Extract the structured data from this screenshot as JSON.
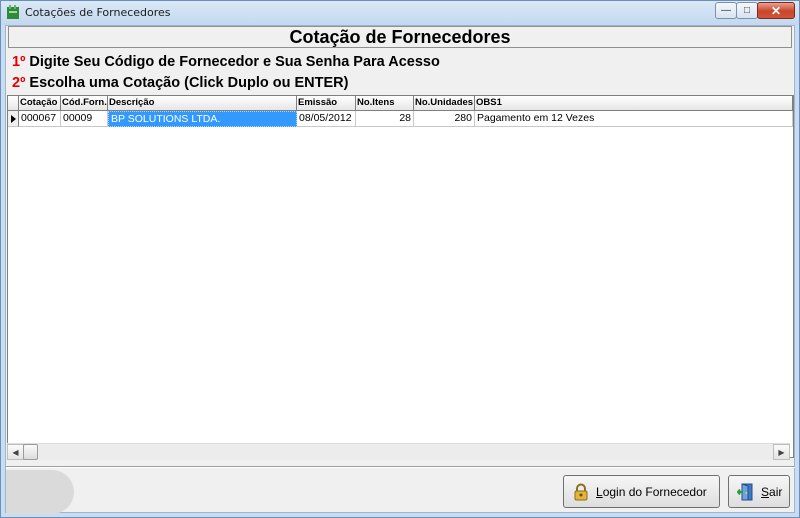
{
  "window": {
    "title": "Cotações de Fornecedores",
    "controls": {
      "minimize": "—",
      "maximize": "□",
      "close": "✕"
    }
  },
  "form": {
    "heading": "Cotação de Fornecedores",
    "instruction1": {
      "num": "1º",
      "text": " Digite Seu Código de Fornecedor e Sua Senha Para Acesso"
    },
    "instruction2": {
      "num": "2º",
      "text": " Escolha uma Cotação  (Click Duplo ou ENTER)"
    }
  },
  "grid": {
    "columns": [
      "Cotação",
      "Cód.Forn.",
      "Descrição",
      "Emissão",
      "No.Itens",
      "No.Unidades",
      "OBS1"
    ],
    "rows": [
      {
        "cotacao": "000067",
        "cod_forn": "00009",
        "descricao": "BP SOLUTIONS LTDA.",
        "emissao": "08/05/2012",
        "no_itens": "28",
        "no_unidades": "280",
        "obs1": "Pagamento em 12 Vezes"
      }
    ]
  },
  "buttons": {
    "login_underlined": "L",
    "login_rest": "ogin do Fornecedor",
    "sair_underlined": "S",
    "sair_rest": "air"
  },
  "icons": {
    "app": "app-icon",
    "login": "padlock-icon",
    "sair": "exit-door-icon"
  },
  "colors": {
    "instruction_number": "#e00000",
    "selection": "#3399ff"
  }
}
